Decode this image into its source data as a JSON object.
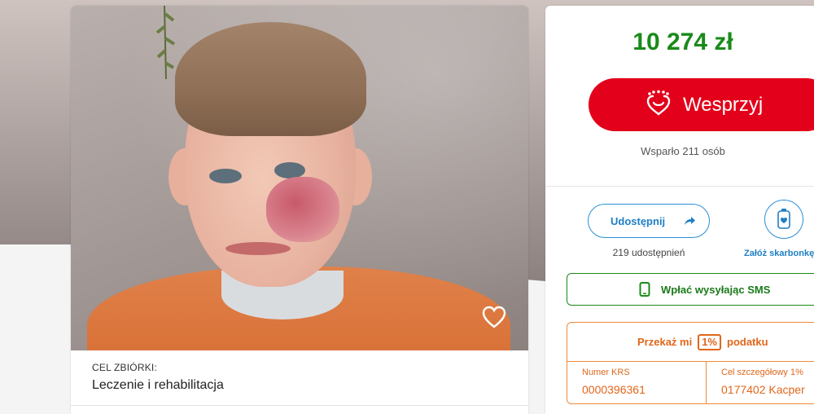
{
  "fundraiser": {
    "goal_label": "CEL ZBIÓRKI:",
    "goal_value": "Leczenie i rehabilitacja",
    "amount": "10 274 zł",
    "donate_label": "Wesprzyj",
    "supporters": "Wsparło 211 osób"
  },
  "share": {
    "button_label": "Udostępnij",
    "count": "219 udostępnień"
  },
  "piggy": {
    "label": "Załóż skarbonkę"
  },
  "sms": {
    "label": "Wpłać wysyłając SMS"
  },
  "tax": {
    "prefix": "Przekaż mi",
    "percent": "1%",
    "suffix": "podatku",
    "krs_label": "Numer KRS",
    "krs_value": "0000396361",
    "goal_label": "Cel szczegółowy 1%",
    "goal_value": "0177402 Kacper"
  },
  "colors": {
    "donate": "#e3001a",
    "amount": "#1a8a1a",
    "share": "#2a8fd6",
    "tax": "#e0661a"
  },
  "icons": [
    "heart-icon",
    "donate-hand-icon",
    "share-arrow-icon",
    "piggy-bank-icon",
    "phone-icon"
  ]
}
